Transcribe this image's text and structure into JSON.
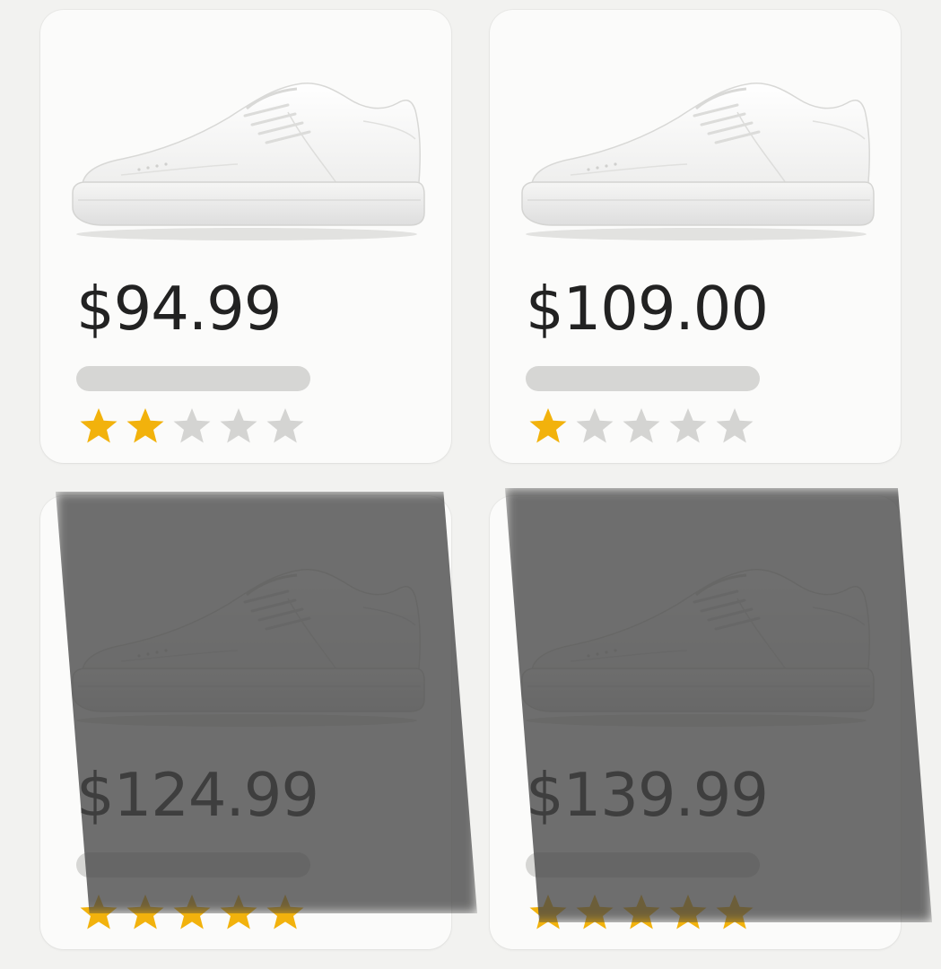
{
  "products": [
    {
      "price": "$94.99",
      "rating": 2,
      "rating_max": 5,
      "image": "white-sneaker"
    },
    {
      "price": "$109.00",
      "rating": 1,
      "rating_max": 5,
      "image": "white-sneaker"
    },
    {
      "price": "$124.99",
      "rating": 5,
      "rating_max": 5,
      "image": "white-sneaker"
    },
    {
      "price": "$139.99",
      "rating": 5,
      "rating_max": 5,
      "image": "white-sneaker"
    }
  ],
  "colors": {
    "star_filled": "#f2b20c",
    "star_empty": "#d4d4d2",
    "card_bg": "#fbfbfa",
    "price_text": "#222222",
    "shadow_overlay": "#464646"
  },
  "icons": {
    "star": "star-icon",
    "product_image": "sneaker-icon"
  }
}
